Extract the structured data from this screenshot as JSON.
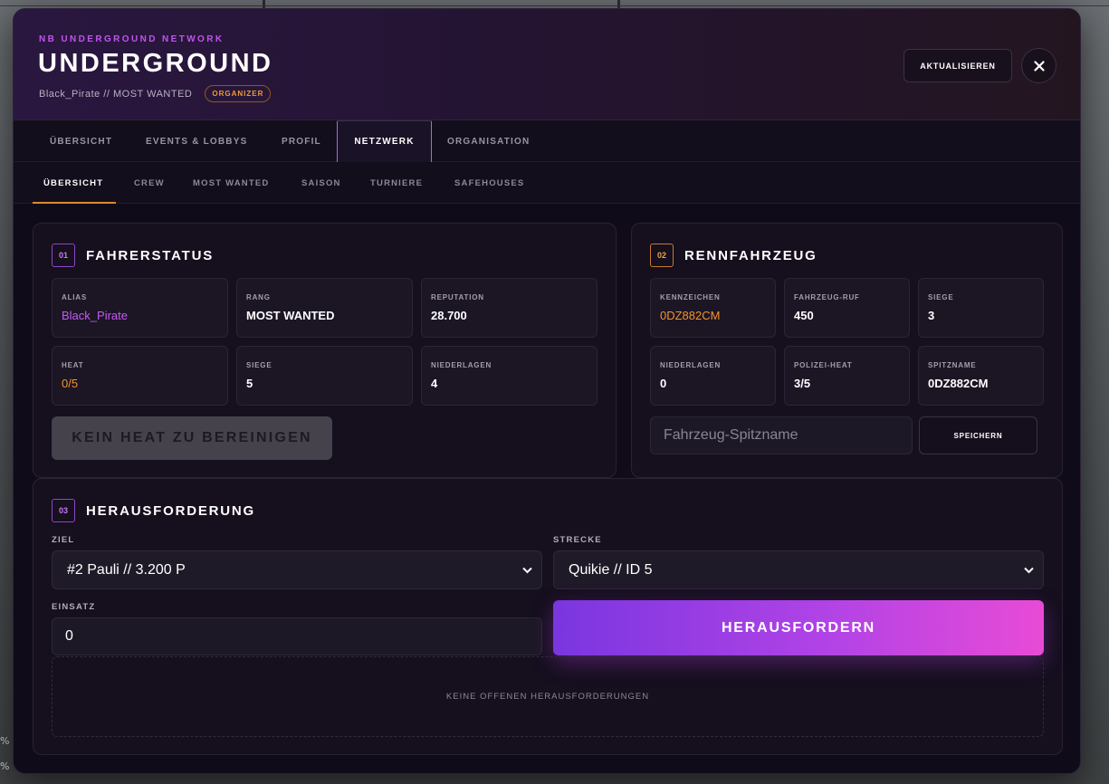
{
  "header": {
    "network_label": "NB UNDERGROUND NETWORK",
    "title": "UNDERGROUND",
    "subtitle": "Black_Pirate // MOST WANTED",
    "role_badge": "ORGANIZER",
    "refresh_label": "AKTUALISIEREN",
    "close_icon": "close-icon"
  },
  "tabs": [
    {
      "label": "ÜBERSICHT",
      "active": false
    },
    {
      "label": "EVENTS & LOBBYS",
      "active": false
    },
    {
      "label": "PROFIL",
      "active": false
    },
    {
      "label": "NETZWERK",
      "active": true
    },
    {
      "label": "ORGANISATION",
      "active": false
    }
  ],
  "subtabs": [
    {
      "label": "ÜBERSICHT",
      "active": true
    },
    {
      "label": "CREW",
      "active": false
    },
    {
      "label": "MOST WANTED",
      "active": false
    },
    {
      "label": "SAISON",
      "active": false
    },
    {
      "label": "TURNIERE",
      "active": false
    },
    {
      "label": "SAFEHOUSES",
      "active": false
    }
  ],
  "driver_status": {
    "number": "01",
    "title": "FAHRERSTATUS",
    "stats": [
      {
        "label": "ALIAS",
        "value": "Black_Pirate"
      },
      {
        "label": "RANG",
        "value": "MOST WANTED"
      },
      {
        "label": "REPUTATION",
        "value": "28.700"
      },
      {
        "label": "HEAT",
        "value": "0/5"
      },
      {
        "label": "SIEGE",
        "value": "5"
      },
      {
        "label": "NIEDERLAGEN",
        "value": "4"
      }
    ],
    "clear_heat_label": "KEIN HEAT ZU BEREINIGEN"
  },
  "race_vehicle": {
    "number": "02",
    "title": "RENNFAHRZEUG",
    "stats": [
      {
        "label": "KENNZEICHEN",
        "value": "0DZ882CM"
      },
      {
        "label": "FAHRZEUG-RUF",
        "value": "450"
      },
      {
        "label": "SIEGE",
        "value": "3"
      },
      {
        "label": "NIEDERLAGEN",
        "value": "0"
      },
      {
        "label": "POLIZEI-HEAT",
        "value": "3/5"
      },
      {
        "label": "SPITZNAME",
        "value": "0DZ882CM"
      }
    ],
    "nickname_placeholder": "Fahrzeug-Spitzname",
    "save_label": "SPEICHERN"
  },
  "challenge": {
    "number": "03",
    "title": "HERAUSFORDERUNG",
    "target_label": "ZIEL",
    "target_value": "#2 Pauli // 3.200 P",
    "track_label": "STRECKE",
    "track_value": "Quikie // ID 5",
    "stake_label": "EINSATZ",
    "stake_value": "0",
    "challenge_button": "HERAUSFORDERN",
    "empty_text": "KEINE OFFENEN HERAUSFORDERUNGEN"
  },
  "edge_marks": [
    "%",
    "%"
  ],
  "colors": {
    "accent_purple": "#c65af4",
    "accent_orange": "#f2932d",
    "panel_bg": "#100b19"
  }
}
